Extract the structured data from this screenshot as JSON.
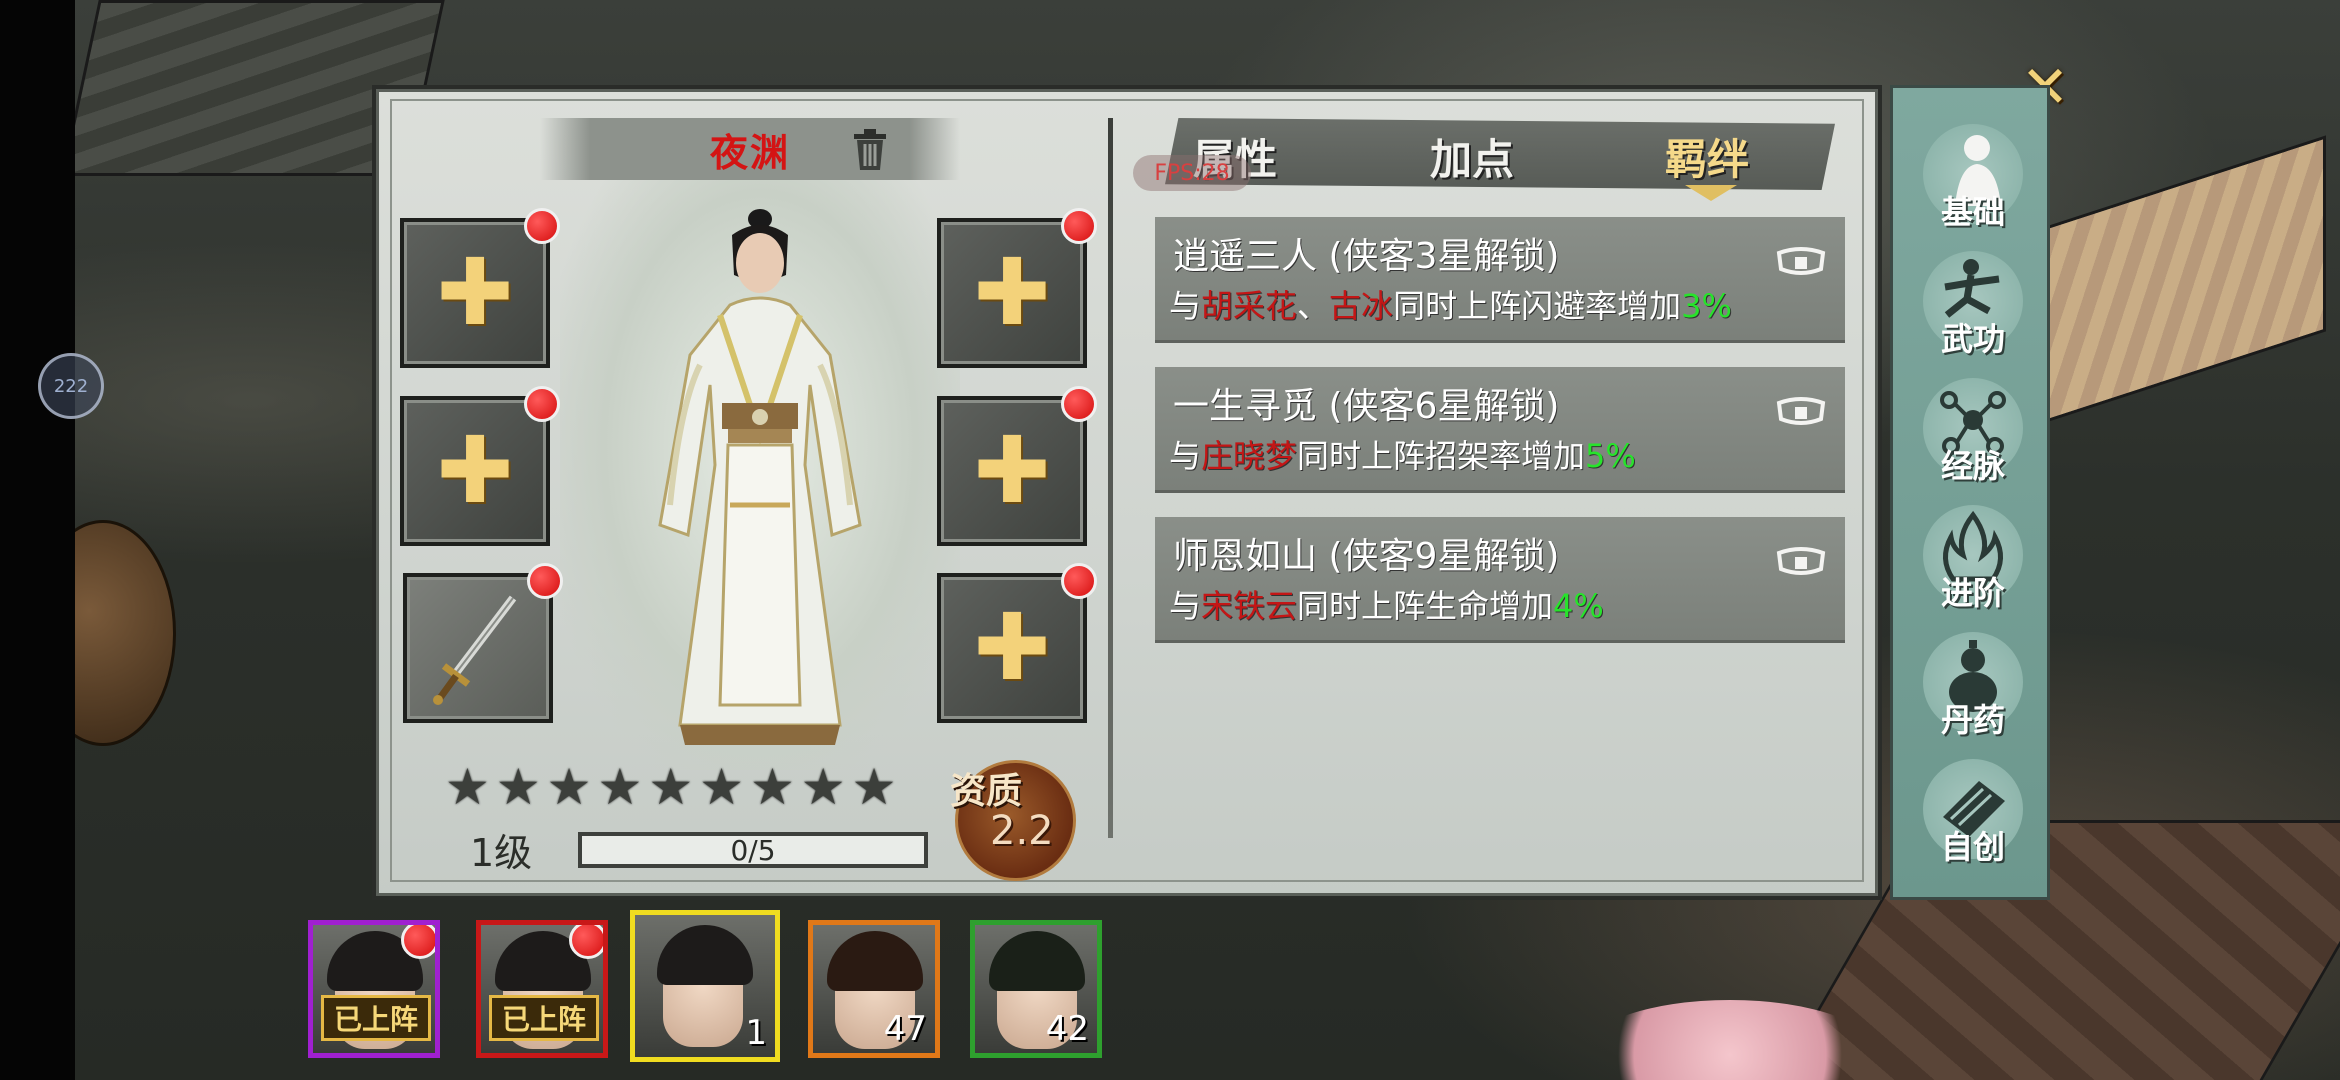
{
  "hud": {
    "fps_indicator": "222"
  },
  "dialog": {
    "close_label": "✕"
  },
  "character": {
    "name": "夜渊",
    "level": "1级",
    "exp": "0/5",
    "stars_filled": 0,
    "stars_total": 9,
    "aptitude_label": "资质",
    "aptitude_value": "2.2"
  },
  "equipment_slots": [
    {
      "id": "left-1",
      "state": "empty",
      "alert": true
    },
    {
      "id": "left-2",
      "state": "empty",
      "alert": true
    },
    {
      "id": "left-3",
      "state": "sword",
      "alert": true
    },
    {
      "id": "right-1",
      "state": "empty",
      "alert": true
    },
    {
      "id": "right-2",
      "state": "empty",
      "alert": true
    },
    {
      "id": "right-3",
      "state": "empty",
      "alert": true
    }
  ],
  "tabs": {
    "attributes": "属性",
    "add_points": "加点",
    "bonds": "羁绊",
    "active": "bonds",
    "fps_tag": "FPS:28"
  },
  "bonds": [
    {
      "title": "逍遥三人 (侠客3星解锁)",
      "prefix": "与",
      "heroes": [
        "胡采花",
        "古冰"
      ],
      "separator": "、",
      "effect": "同时上阵闪避率增加",
      "percent": "3%"
    },
    {
      "title": "一生寻觅 (侠客6星解锁)",
      "prefix": "与",
      "heroes": [
        "庄晓梦"
      ],
      "effect": "同时上阵招架率增加",
      "percent": "5%"
    },
    {
      "title": "师恩如山 (侠客9星解锁)",
      "prefix": "与",
      "heroes": [
        "宋铁云"
      ],
      "effect": "同时上阵生命增加",
      "percent": "4%"
    }
  ],
  "side_tabs": [
    {
      "label": "基础",
      "icon": "person-icon",
      "active": true
    },
    {
      "label": "武功",
      "icon": "martial-arts-icon",
      "active": false
    },
    {
      "label": "经脉",
      "icon": "meridian-icon",
      "active": false
    },
    {
      "label": "进阶",
      "icon": "flame-icon",
      "active": false
    },
    {
      "label": "丹药",
      "icon": "gourd-icon",
      "active": false
    },
    {
      "label": "自创",
      "icon": "scroll-icon",
      "active": false
    }
  ],
  "roster": [
    {
      "frame_color": "#a020d0",
      "badge": "已上阵",
      "count": "",
      "alert": true
    },
    {
      "frame_color": "#c81818",
      "badge": "已上阵",
      "count": "",
      "alert": true
    },
    {
      "frame_color": "#f0dc20",
      "badge": "",
      "count": "1",
      "alert": false,
      "selected": true
    },
    {
      "frame_color": "#e07818",
      "badge": "",
      "count": "47",
      "alert": false
    },
    {
      "frame_color": "#2ea02e",
      "badge": "",
      "count": "42",
      "alert": false
    }
  ]
}
